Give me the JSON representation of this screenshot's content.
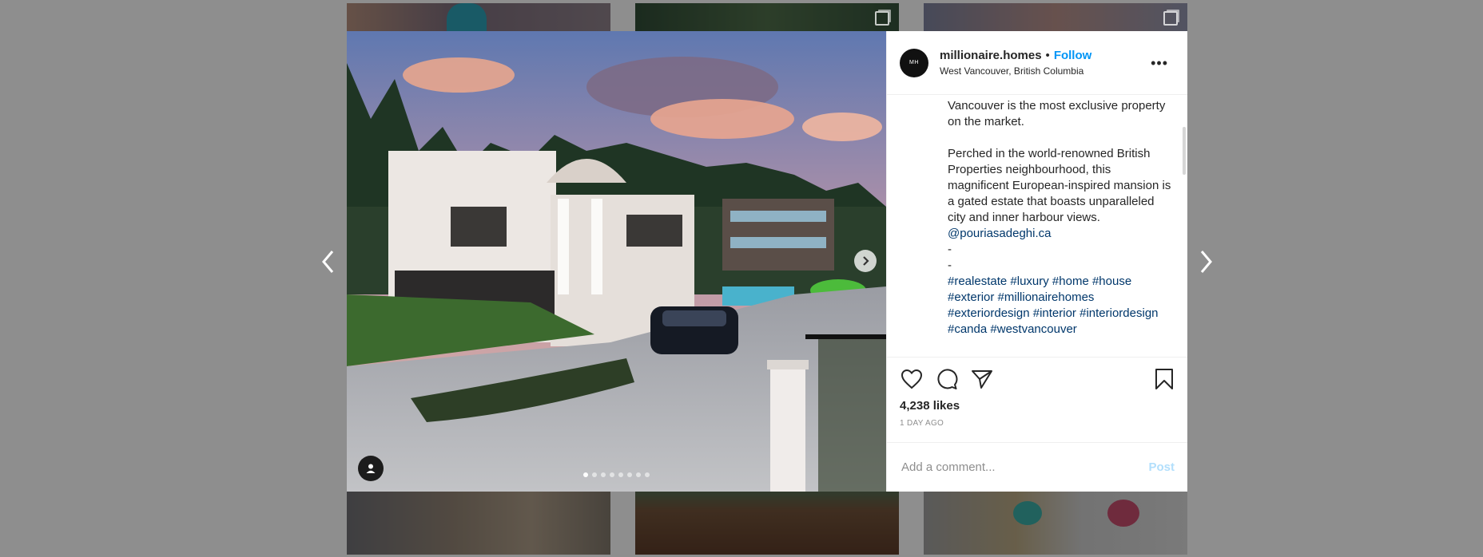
{
  "header": {
    "username": "millionaire.homes",
    "separator": "•",
    "follow_label": "Follow",
    "location": "West Vancouver, British Columbia",
    "avatar_text": "MH",
    "more_icon": "more-options-icon"
  },
  "caption": {
    "para1": "Vancouver is the most exclusive property on the market.",
    "para2_text": "Perched in the world-renowned British Properties neighbourhood, this magnificent European-inspired mansion is a gated estate that boasts unparalleled city and inner harbour views.",
    "mention": "@pouriasadeghi.ca",
    "dash1": "-",
    "dash2": "-",
    "hashtags": [
      "#realestate",
      "#luxury",
      "#home",
      "#house",
      "#exterior",
      "#millionairehomes",
      "#exteriordesign",
      "#interior",
      "#interiordesign",
      "#canda",
      "#westvancouver"
    ]
  },
  "actions": {
    "like_icon": "heart-icon",
    "comment_icon": "comment-icon",
    "share_icon": "share-icon",
    "save_icon": "bookmark-icon",
    "likes": "4,238 likes",
    "time": "1 DAY AGO"
  },
  "comment": {
    "placeholder": "Add a comment...",
    "post_label": "Post"
  },
  "carousel": {
    "total": 8,
    "active_index": 0
  },
  "colors": {
    "follow": "#0095f6",
    "hashtag": "#00376b",
    "post_disabled": "#b2dffc",
    "overlay": "#8e8e8e"
  }
}
